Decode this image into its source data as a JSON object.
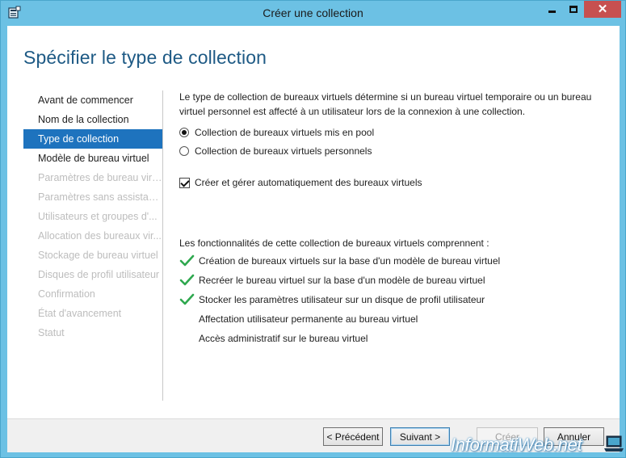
{
  "window": {
    "title": "Créer une collection",
    "close_glyph": "✕",
    "accent_color": "#6cc1e4",
    "app_icon": "server-manager-icon"
  },
  "header": {
    "page_title": "Spécifier le type de collection"
  },
  "nav": {
    "items": [
      {
        "label": "Avant de commencer",
        "state": "normal"
      },
      {
        "label": "Nom de la collection",
        "state": "normal"
      },
      {
        "label": "Type de collection",
        "state": "active"
      },
      {
        "label": "Modèle de bureau virtuel",
        "state": "normal"
      },
      {
        "label": "Paramètres de bureau virt...",
        "state": "disabled"
      },
      {
        "label": "Paramètres sans assistance",
        "state": "disabled"
      },
      {
        "label": "Utilisateurs et groupes d'...",
        "state": "disabled"
      },
      {
        "label": "Allocation des bureaux vir...",
        "state": "disabled"
      },
      {
        "label": "Stockage de bureau virtuel",
        "state": "disabled"
      },
      {
        "label": "Disques de profil utilisateur",
        "state": "disabled"
      },
      {
        "label": "Confirmation",
        "state": "disabled"
      },
      {
        "label": "État d'avancement",
        "state": "disabled"
      },
      {
        "label": "Statut",
        "state": "disabled"
      }
    ]
  },
  "content": {
    "intro": "Le type de collection de bureaux virtuels détermine si un bureau virtuel temporaire ou un bureau virtuel personnel est affecté à un utilisateur lors de la connexion à une collection.",
    "radio_pooled": "Collection de bureaux virtuels mis en pool",
    "radio_personal": "Collection de bureaux virtuels personnels",
    "radio_selected": "pooled",
    "checkbox_auto": "Créer et gérer automatiquement des bureaux virtuels",
    "checkbox_auto_checked": true,
    "features_heading": "Les fonctionnalités de cette collection de bureaux virtuels comprennent :",
    "features": [
      {
        "label": "Création de bureaux virtuels sur la base d'un modèle de bureau virtuel",
        "enabled": true
      },
      {
        "label": "Recréer le bureau virtuel sur la base d'un modèle de bureau virtuel",
        "enabled": true
      },
      {
        "label": "Stocker les paramètres utilisateur sur un disque de profil utilisateur",
        "enabled": true
      },
      {
        "label": "Affectation utilisateur permanente au bureau virtuel",
        "enabled": false
      },
      {
        "label": "Accès administratif sur le bureau virtuel",
        "enabled": false
      }
    ]
  },
  "footer": {
    "prev_label": "< Précédent",
    "next_label": "Suivant >",
    "create_label": "Créer",
    "cancel_label": "Annuler"
  },
  "watermark": {
    "text": "InformatiWeb.net"
  }
}
